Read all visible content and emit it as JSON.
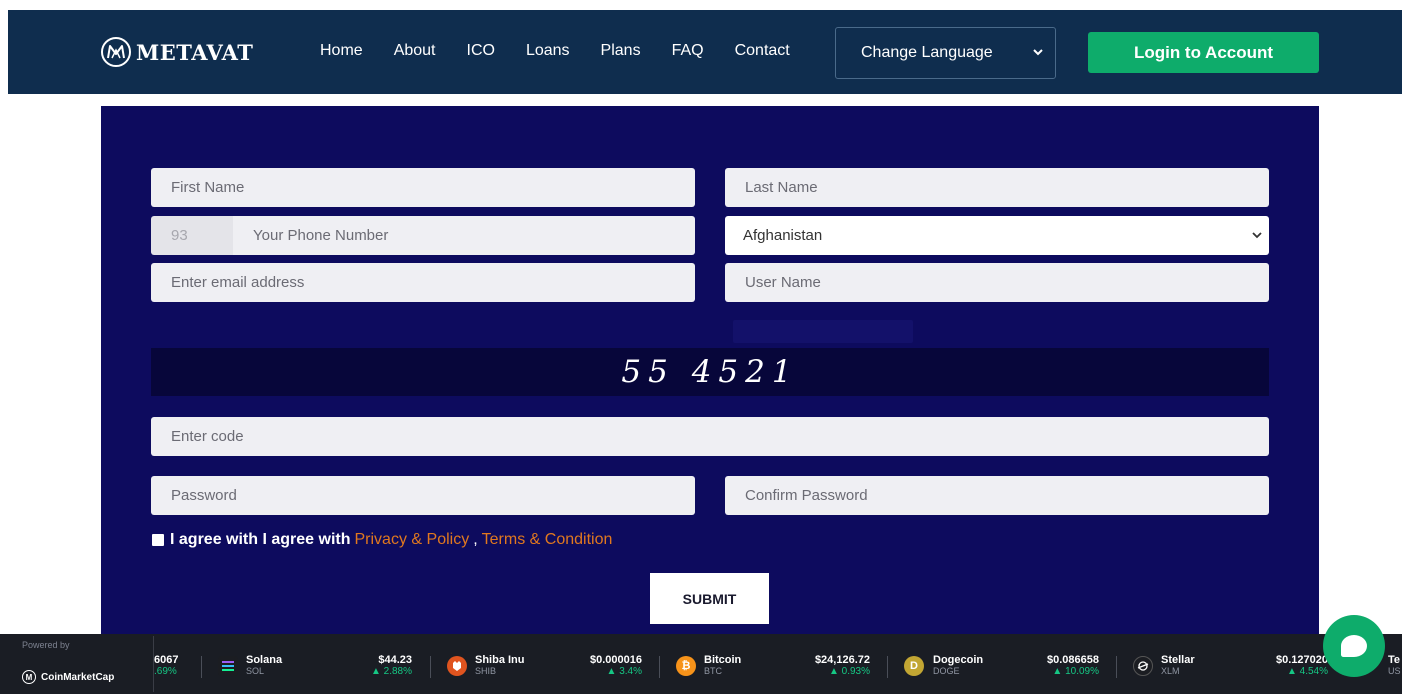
{
  "brand": {
    "name": "METAVAT"
  },
  "nav": {
    "links": [
      "Home",
      "About",
      "ICO",
      "Loans",
      "Plans",
      "FAQ",
      "Contact"
    ],
    "language_label": "Change Language",
    "login_label": "Login to Account"
  },
  "form": {
    "first_name_placeholder": "First Name",
    "last_name_placeholder": "Last Name",
    "phone_prefix": "93",
    "phone_placeholder": "Your Phone Number",
    "country_selected": "Afghanistan",
    "email_placeholder": "Enter email address",
    "username_placeholder": "User Name",
    "captcha_text": "55 4521",
    "code_placeholder": "Enter code",
    "password_placeholder": "Password",
    "confirm_password_placeholder": "Confirm Password",
    "agree_text": "I agree with I agree with",
    "privacy_link": "Privacy & Policy",
    "comma": ",",
    "terms_link": "Terms & Condition",
    "submit_label": "SUBMIT"
  },
  "ticker": {
    "powered_by": "Powered by",
    "provider": "CoinMarketCap",
    "partial_price": "6067",
    "partial_change": ".69%",
    "coins": [
      {
        "name": "Solana",
        "symbol": "SOL",
        "price": "$44.23",
        "change": "▲ 2.88%",
        "icon_color": "#1b1d22",
        "icon": "solana-icon"
      },
      {
        "name": "Shiba Inu",
        "symbol": "SHIB",
        "price": "$0.000016",
        "change": "▲ 3.4%",
        "icon_color": "#e0541f",
        "icon": "shiba-icon"
      },
      {
        "name": "Bitcoin",
        "symbol": "BTC",
        "price": "$24,126.72",
        "change": "▲ 0.93%",
        "icon_color": "#f7931a",
        "icon": "bitcoin-icon"
      },
      {
        "name": "Dogecoin",
        "symbol": "DOGE",
        "price": "$0.086658",
        "change": "▲ 10.09%",
        "icon_color": "#c2a633",
        "icon": "dogecoin-icon"
      },
      {
        "name": "Stellar",
        "symbol": "XLM",
        "price": "$0.127020",
        "change": "▲ 4.54%",
        "icon_color": "#1b1d22",
        "icon": "stellar-icon"
      }
    ],
    "partial_next_name": "Te",
    "partial_next_symbol": "US"
  }
}
